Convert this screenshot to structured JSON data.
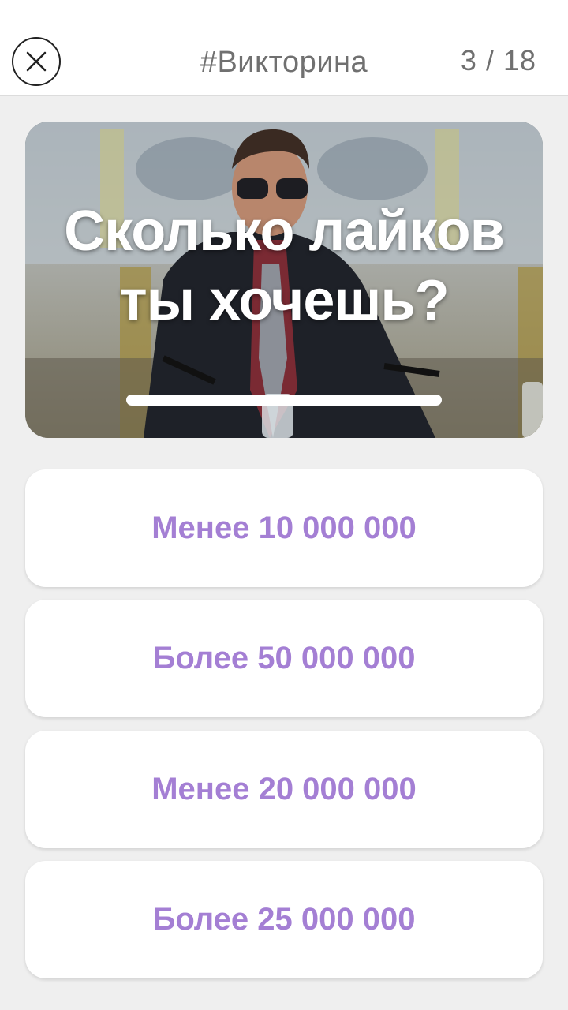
{
  "header": {
    "title": "#Викторина",
    "counter": "3 / 18",
    "close_icon": "close-x-icon"
  },
  "question": {
    "line1": "Сколько лайков",
    "line2": "ты хочешь?",
    "timer_progress": 1.0
  },
  "answers": [
    {
      "label": "Менее 10 000 000"
    },
    {
      "label": "Более 50 000 000"
    },
    {
      "label": "Менее 20 000 000"
    },
    {
      "label": "Более 25 000 000"
    }
  ],
  "colors": {
    "accent": "#a47fd4",
    "background": "#efefef",
    "card": "#ffffff"
  }
}
